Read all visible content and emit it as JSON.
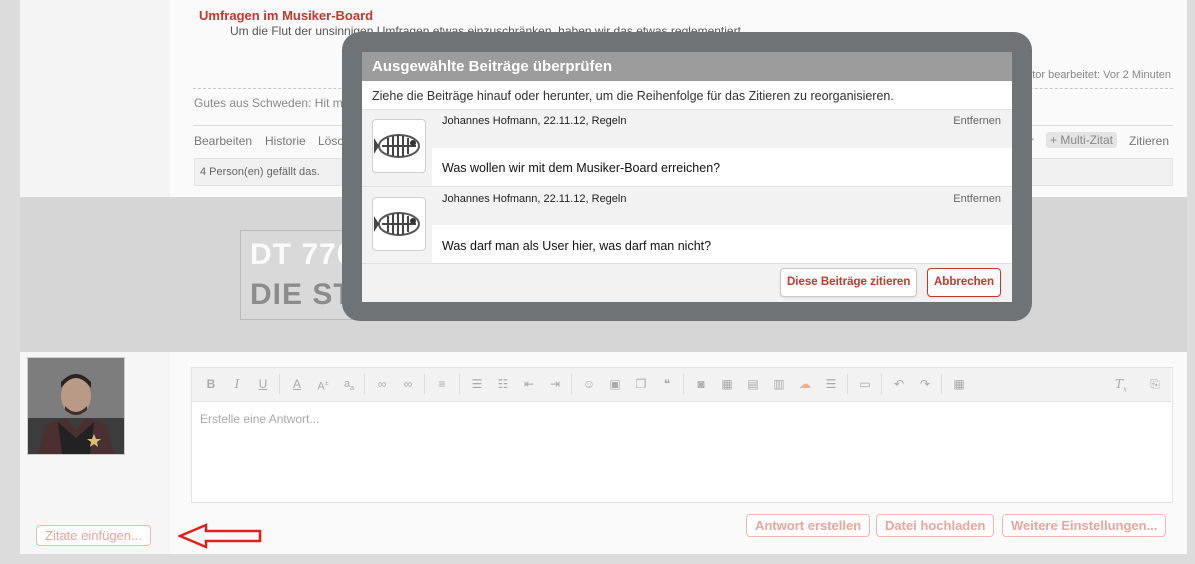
{
  "post": {
    "title": "Umfragen im Musiker-Board",
    "text": "Um die Flut der unsinnigen Umfragen etwas einzuschränken, haben wir das etwas reglementiert.",
    "edited_note": "derator bearbeitet: Vor 2 Minuten",
    "signature": "Gutes aus Schweden: Hit me",
    "actions": {
      "edit": "Bearbeiten",
      "history": "Historie",
      "delete": "Löschen",
      "like": "mr",
      "multi_quote": "+ Multi-Zitat",
      "quote": "Zitieren"
    },
    "likes": "4 Person(en) gefällt das."
  },
  "banner": {
    "line1": "DT 770",
    "line2": "DIE STUDIO LEGENDEN"
  },
  "reply": {
    "placeholder": "Erstelle eine Antwort...",
    "insert_quotes": "Zitate einfügen...",
    "submit": "Antwort erstellen",
    "upload": "Datei hochladen",
    "more": "Weitere Einstellungen..."
  },
  "toolbar_icons": [
    "bold-icon",
    "italic-icon",
    "underline-icon",
    "font-color-icon",
    "font-size-icon",
    "font-family-icon",
    "link-icon",
    "unlink-icon",
    "align-icon",
    "bullet-list-icon",
    "numbered-list-icon",
    "outdent-icon",
    "indent-icon",
    "smilie-icon",
    "image-icon",
    "media-icon",
    "quote-icon",
    "screenshot-icon",
    "table-icon",
    "code-icon",
    "spoiler-icon",
    "soundcloud-icon",
    "hr-icon",
    "save-icon",
    "undo-icon",
    "redo-icon",
    "bbcode-icon",
    "remove-format-icon",
    "draft-icon"
  ],
  "modal": {
    "title": "Ausgewählte Beiträge überprüfen",
    "description": "Ziehe die Beiträge hinauf oder herunter, um die Reihenfolge für das Zitieren zu reorganisieren.",
    "items": [
      {
        "meta": "Johannes Hofmann, 22.11.12, Regeln",
        "remove": "Entfernen",
        "text": "Was wollen wir mit dem Musiker-Board erreichen?"
      },
      {
        "meta": "Johannes Hofmann, 22.11.12, Regeln",
        "remove": "Entfernen",
        "text": "Was darf man als User hier, was darf man nicht?"
      }
    ],
    "quote_button": "Diese Beiträge zitieren",
    "cancel_button": "Abbrechen"
  },
  "colors": {
    "accent": "#c0392b",
    "modal_header": "#9c9c9c",
    "annotation_arrow": "#e02020"
  }
}
